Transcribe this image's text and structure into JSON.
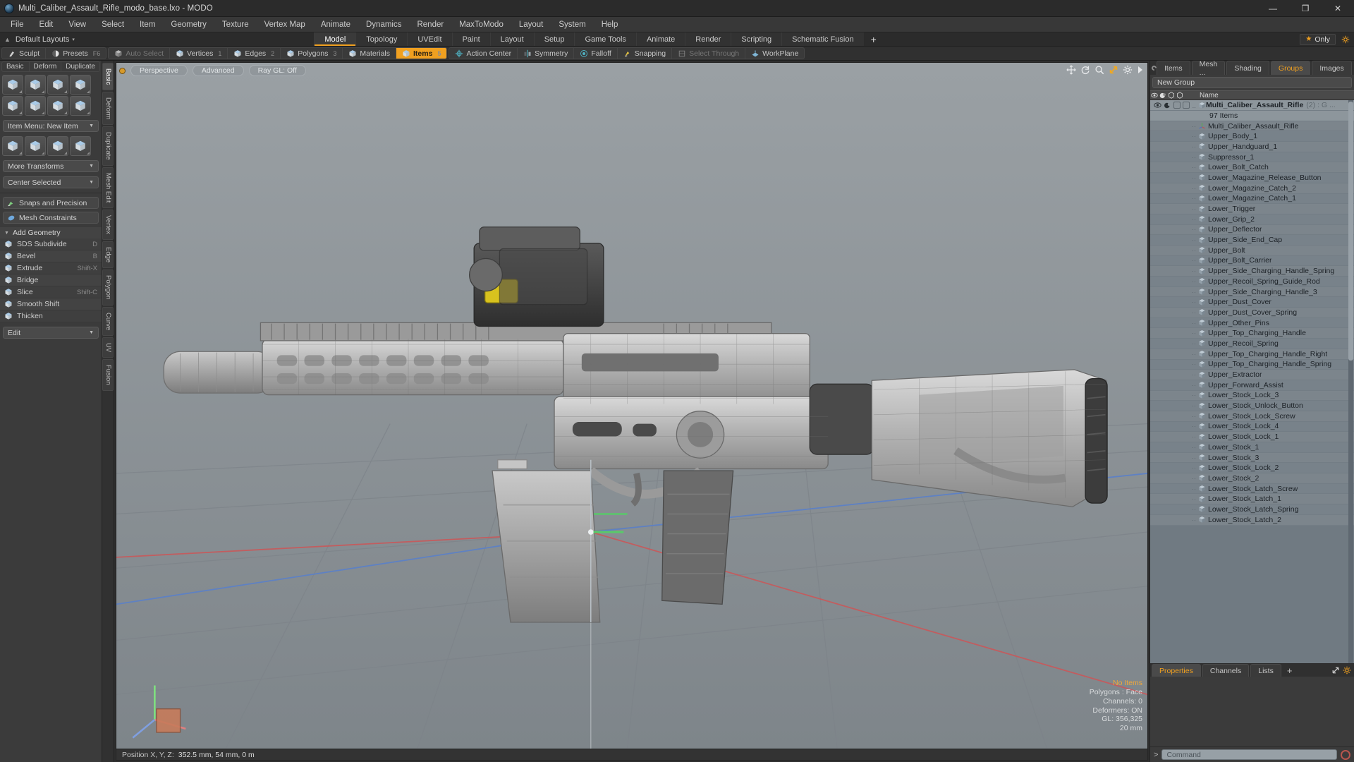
{
  "window": {
    "title": "Multi_Caliber_Assault_Rifle_modo_base.lxo - MODO",
    "minimize": "—",
    "maximize": "❐",
    "close": "✕"
  },
  "menubar": [
    "File",
    "Edit",
    "View",
    "Select",
    "Item",
    "Geometry",
    "Texture",
    "Vertex Map",
    "Animate",
    "Dynamics",
    "Render",
    "MaxToModo",
    "Layout",
    "System",
    "Help"
  ],
  "layoutrow": {
    "preset_label": "Default Layouts",
    "caret": "▾",
    "tabs": [
      {
        "label": "Model",
        "active": true
      },
      {
        "label": "Topology",
        "active": false
      },
      {
        "label": "UVEdit",
        "active": false
      },
      {
        "label": "Paint",
        "active": false
      },
      {
        "label": "Layout",
        "active": false
      },
      {
        "label": "Setup",
        "active": false
      },
      {
        "label": "Game Tools",
        "active": false
      },
      {
        "label": "Animate",
        "active": false
      },
      {
        "label": "Render",
        "active": false
      },
      {
        "label": "Scripting",
        "active": false
      },
      {
        "label": "Schematic Fusion",
        "active": false
      }
    ],
    "add_tab": "+",
    "only_label": "Only"
  },
  "modebar": {
    "group_left": [
      {
        "label": "Sculpt",
        "icon": "brush-icon",
        "active": false,
        "dim": false,
        "num": ""
      },
      {
        "label": "Presets",
        "icon": "sphere-icon",
        "active": false,
        "dim": false,
        "num": "F6"
      }
    ],
    "group_select": [
      {
        "label": "Auto Select",
        "icon": "cube-gray-icon",
        "active": false,
        "dim": true,
        "num": ""
      },
      {
        "label": "Vertices",
        "icon": "cube-vertex-icon",
        "active": false,
        "dim": false,
        "num": "1"
      },
      {
        "label": "Edges",
        "icon": "cube-edge-icon",
        "active": false,
        "dim": false,
        "num": "2"
      },
      {
        "label": "Polygons",
        "icon": "cube-poly-icon",
        "active": false,
        "dim": false,
        "num": "3"
      },
      {
        "label": "Materials",
        "icon": "cube-material-icon",
        "active": false,
        "dim": false,
        "num": ""
      },
      {
        "label": "Items",
        "icon": "cube-item-icon",
        "active": true,
        "dim": false,
        "num": "5"
      }
    ],
    "group_tools": [
      {
        "label": "Action Center",
        "icon": "action-center-icon",
        "active": false,
        "dim": false,
        "num": ""
      },
      {
        "label": "Symmetry",
        "icon": "symmetry-icon",
        "active": false,
        "dim": false,
        "num": ""
      },
      {
        "label": "Falloff",
        "icon": "falloff-icon",
        "active": false,
        "dim": false,
        "num": ""
      },
      {
        "label": "Snapping",
        "icon": "snapping-icon",
        "active": false,
        "dim": false,
        "num": ""
      },
      {
        "label": "Select Through",
        "icon": "select-through-icon",
        "active": false,
        "dim": true,
        "num": ""
      },
      {
        "label": "WorkPlane",
        "icon": "workplane-icon",
        "active": false,
        "dim": false,
        "num": ""
      }
    ]
  },
  "leftpanel": {
    "header": [
      {
        "label": "Basic"
      },
      {
        "label": "Deform"
      },
      {
        "label": "Duplicate"
      }
    ],
    "tiles_row1": [
      "box-tool",
      "sphere-tool",
      "cylinder-tool",
      "cone-tool"
    ],
    "tiles_row2": [
      "torus-tool",
      "tube-tool",
      "teardrop-tool",
      "text-tool"
    ],
    "item_menu": "Item Menu: New Item",
    "tiles_row3": [
      "move-tool",
      "rotate-tool",
      "scale-tool",
      "transform-tool"
    ],
    "more_transforms": "More Transforms",
    "center_selected": "Center Selected",
    "snaps": "Snaps and Precision",
    "mesh_constraints": "Mesh Constraints",
    "add_geometry_header": "Add Geometry",
    "tools": [
      {
        "label": "SDS Subdivide",
        "shortcut": "D",
        "icon": "sds-icon"
      },
      {
        "label": "Bevel",
        "shortcut": "B",
        "icon": "bevel-icon"
      },
      {
        "label": "Extrude",
        "shortcut": "Shift-X",
        "icon": "extrude-icon"
      },
      {
        "label": "Bridge",
        "shortcut": "",
        "icon": "bridge-icon"
      },
      {
        "label": "Slice",
        "shortcut": "Shift-C",
        "icon": "slice-icon"
      },
      {
        "label": "Smooth Shift",
        "shortcut": "",
        "icon": "smooth-shift-icon"
      },
      {
        "label": "Thicken",
        "shortcut": "",
        "icon": "thicken-icon"
      }
    ],
    "edit_combo": "Edit",
    "vtabs": [
      {
        "label": "Basic",
        "active": true
      },
      {
        "label": "Deform",
        "active": false
      },
      {
        "label": "Duplicate",
        "active": false
      },
      {
        "label": "Mesh Edit",
        "active": false
      },
      {
        "label": "Vertex",
        "active": false
      },
      {
        "label": "Edge",
        "active": false
      },
      {
        "label": "Polygon",
        "active": false
      },
      {
        "label": "Curve",
        "active": false
      },
      {
        "label": "UV",
        "active": false
      },
      {
        "label": "Fusion",
        "active": false
      }
    ]
  },
  "viewport": {
    "pills": [
      "Perspective",
      "Advanced",
      "Ray GL: Off"
    ],
    "tool_icons": [
      "move-view-icon",
      "rotate-view-icon",
      "zoom-view-icon",
      "fit-view-icon",
      "gear-icon",
      "chevron-right-icon"
    ],
    "stats": {
      "no_items": "No Items",
      "polygons": "Polygons : Face",
      "channels": "Channels: 0",
      "deformers": "Deformers: ON",
      "gl": "GL: 356,325",
      "scale": "20 mm"
    }
  },
  "statusbar": {
    "label": "Position X, Y, Z:",
    "value": "352.5 mm, 54 mm, 0 m"
  },
  "rightpanel": {
    "tabs": [
      {
        "label": "Items",
        "active": false
      },
      {
        "label": "Mesh ...",
        "active": false
      },
      {
        "label": "Shading",
        "active": false
      },
      {
        "label": "Groups",
        "active": true
      },
      {
        "label": "Images",
        "active": false
      }
    ],
    "add_tab": "+",
    "new_group": "New Group",
    "columns": [
      "eye-col",
      "shade-col",
      "render-col",
      "select-col",
      "Name"
    ],
    "name_header": "Name",
    "group_item": {
      "name": "Multi_Caliber_Assault_Rifle",
      "count": "(2)",
      "suffix": ": G ...",
      "items_label": "97 Items"
    },
    "items": [
      "Multi_Caliber_Assault_Rifle",
      "Upper_Body_1",
      "Upper_Handguard_1",
      "Suppressor_1",
      "Lower_Bolt_Catch",
      "Lower_Magazine_Release_Button",
      "Lower_Magazine_Catch_2",
      "Lower_Magazine_Catch_1",
      "Lower_Trigger",
      "Lower_Grip_2",
      "Upper_Deflector",
      "Upper_Side_End_Cap",
      "Upper_Bolt",
      "Upper_Bolt_Carrier",
      "Upper_Side_Charging_Handle_Spring",
      "Upper_Recoil_Spring_Guide_Rod",
      "Upper_Side_Charging_Handle_3",
      "Upper_Dust_Cover",
      "Upper_Dust_Cover_Spring",
      "Upper_Other_Pins",
      "Upper_Top_Charging_Handle",
      "Upper_Recoil_Spring",
      "Upper_Top_Charging_Handle_Right",
      "Upper_Top_Charging_Handle_Spring",
      "Upper_Extractor",
      "Upper_Forward_Assist",
      "Lower_Stock_Lock_3",
      "Lower_Stock_Unlock_Button",
      "Lower_Stock_Lock_Screw",
      "Lower_Stock_Lock_4",
      "Lower_Stock_Lock_1",
      "Lower_Stock_1",
      "Lower_Stock_3",
      "Lower_Stock_Lock_2",
      "Lower_Stock_2",
      "Lower_Stock_Latch_Screw",
      "Lower_Stock_Latch_1",
      "Lower_Stock_Latch_Spring",
      "Lower_Stock_Latch_2"
    ],
    "bottom_tabs": [
      {
        "label": "Properties",
        "active": true
      },
      {
        "label": "Channels",
        "active": false
      },
      {
        "label": "Lists",
        "active": false
      }
    ],
    "bottom_add": "+"
  },
  "command": {
    "prompt": ">",
    "placeholder": "Command"
  },
  "colors": {
    "accent": "#f0a020",
    "panel": "#3b3b3b",
    "viewport": "#8b9094",
    "list": "#7c858c"
  }
}
